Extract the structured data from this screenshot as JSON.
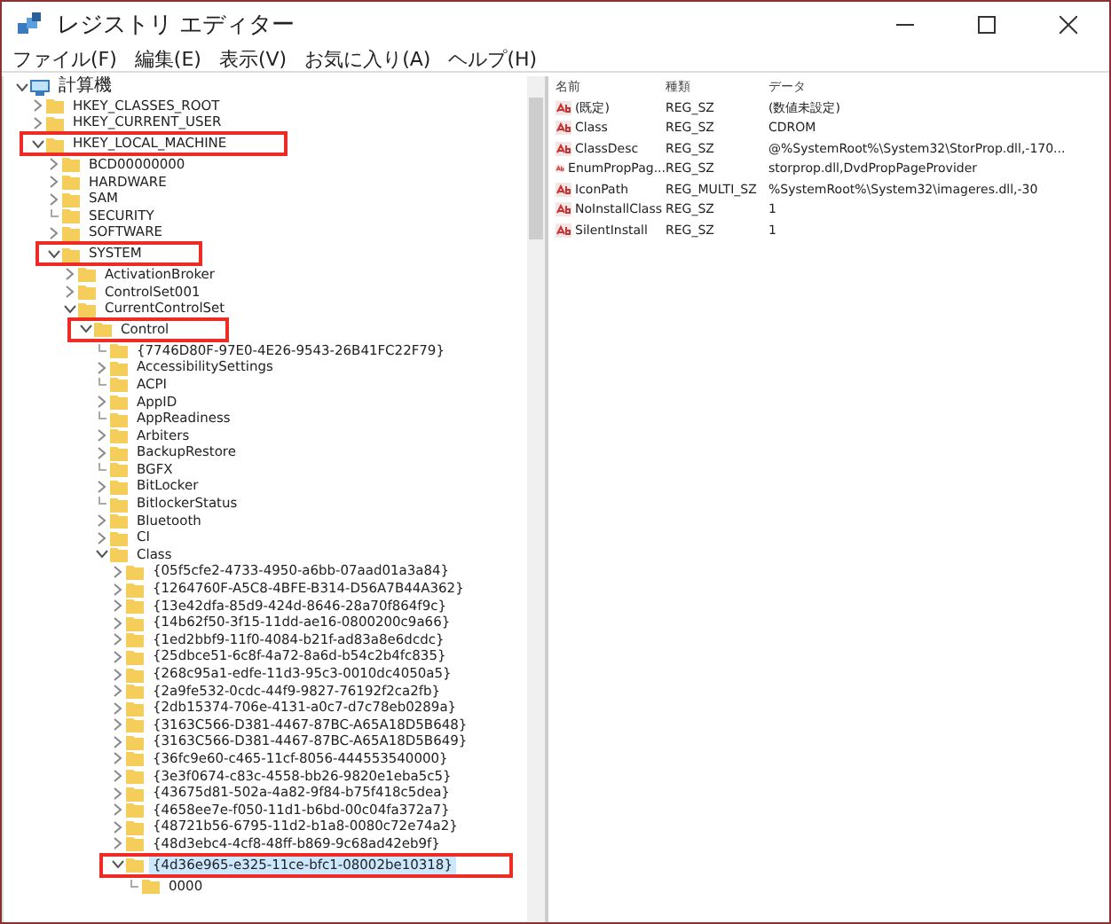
{
  "window": {
    "title": "レジストリ エディター"
  },
  "menu": [
    "ファイル(F)",
    "編集(E)",
    "表示(V)",
    "お気に入り(A)",
    "ヘルプ(H)"
  ],
  "tree": [
    {
      "label": "計算機",
      "kind": "expanded",
      "selected": false,
      "highlighted": false,
      "children": [
        {
          "label": "HKEY_CLASSES_ROOT",
          "kind": "collapsed",
          "selected": false,
          "highlighted": false
        },
        {
          "label": "HKEY_CURRENT_USER",
          "kind": "collapsed",
          "selected": false,
          "highlighted": false
        },
        {
          "label": "HKEY_LOCAL_MACHINE",
          "kind": "expanded",
          "selected": false,
          "highlighted": true,
          "children": [
            {
              "label": "BCD00000000",
              "kind": "collapsed",
              "selected": false,
              "highlighted": false
            },
            {
              "label": "HARDWARE",
              "kind": "collapsed",
              "selected": false,
              "highlighted": false
            },
            {
              "label": "SAM",
              "kind": "collapsed",
              "selected": false,
              "highlighted": false
            },
            {
              "label": "SECURITY",
              "kind": "leaf",
              "selected": false,
              "highlighted": false
            },
            {
              "label": "SOFTWARE",
              "kind": "collapsed",
              "selected": false,
              "highlighted": false
            },
            {
              "label": "SYSTEM",
              "kind": "expanded",
              "selected": false,
              "highlighted": true,
              "children": [
                {
                  "label": "ActivationBroker",
                  "kind": "collapsed",
                  "selected": false,
                  "highlighted": false
                },
                {
                  "label": "ControlSet001",
                  "kind": "collapsed",
                  "selected": false,
                  "highlighted": false
                },
                {
                  "label": "CurrentControlSet",
                  "kind": "expanded",
                  "selected": false,
                  "highlighted": false,
                  "children": [
                    {
                      "label": "Control",
                      "kind": "expanded",
                      "selected": false,
                      "highlighted": true,
                      "children": [
                        {
                          "label": "{7746D80F-97E0-4E26-9543-26B41FC22F79}",
                          "kind": "leaf",
                          "selected": false,
                          "highlighted": false
                        },
                        {
                          "label": "AccessibilitySettings",
                          "kind": "collapsed",
                          "selected": false,
                          "highlighted": false
                        },
                        {
                          "label": "ACPI",
                          "kind": "leaf",
                          "selected": false,
                          "highlighted": false
                        },
                        {
                          "label": "AppID",
                          "kind": "collapsed",
                          "selected": false,
                          "highlighted": false
                        },
                        {
                          "label": "AppReadiness",
                          "kind": "leaf",
                          "selected": false,
                          "highlighted": false
                        },
                        {
                          "label": "Arbiters",
                          "kind": "collapsed",
                          "selected": false,
                          "highlighted": false
                        },
                        {
                          "label": "BackupRestore",
                          "kind": "collapsed",
                          "selected": false,
                          "highlighted": false
                        },
                        {
                          "label": "BGFX",
                          "kind": "leaf",
                          "selected": false,
                          "highlighted": false
                        },
                        {
                          "label": "BitLocker",
                          "kind": "collapsed",
                          "selected": false,
                          "highlighted": false
                        },
                        {
                          "label": "BitlockerStatus",
                          "kind": "leaf",
                          "selected": false,
                          "highlighted": false
                        },
                        {
                          "label": "Bluetooth",
                          "kind": "collapsed",
                          "selected": false,
                          "highlighted": false
                        },
                        {
                          "label": "CI",
                          "kind": "collapsed",
                          "selected": false,
                          "highlighted": false
                        },
                        {
                          "label": "Class",
                          "kind": "expanded",
                          "selected": false,
                          "highlighted": false,
                          "children": [
                            {
                              "label": "{05f5cfe2-4733-4950-a6bb-07aad01a3a84}",
                              "kind": "collapsed",
                              "selected": false,
                              "highlighted": false
                            },
                            {
                              "label": "{1264760F-A5C8-4BFE-B314-D56A7B44A362}",
                              "kind": "collapsed",
                              "selected": false,
                              "highlighted": false
                            },
                            {
                              "label": "{13e42dfa-85d9-424d-8646-28a70f864f9c}",
                              "kind": "collapsed",
                              "selected": false,
                              "highlighted": false
                            },
                            {
                              "label": "{14b62f50-3f15-11dd-ae16-0800200c9a66}",
                              "kind": "collapsed",
                              "selected": false,
                              "highlighted": false
                            },
                            {
                              "label": "{1ed2bbf9-11f0-4084-b21f-ad83a8e6dcdc}",
                              "kind": "collapsed",
                              "selected": false,
                              "highlighted": false
                            },
                            {
                              "label": "{25dbce51-6c8f-4a72-8a6d-b54c2b4fc835}",
                              "kind": "collapsed",
                              "selected": false,
                              "highlighted": false
                            },
                            {
                              "label": "{268c95a1-edfe-11d3-95c3-0010dc4050a5}",
                              "kind": "collapsed",
                              "selected": false,
                              "highlighted": false
                            },
                            {
                              "label": "{2a9fe532-0cdc-44f9-9827-76192f2ca2fb}",
                              "kind": "collapsed",
                              "selected": false,
                              "highlighted": false
                            },
                            {
                              "label": "{2db15374-706e-4131-a0c7-d7c78eb0289a}",
                              "kind": "collapsed",
                              "selected": false,
                              "highlighted": false
                            },
                            {
                              "label": "{3163C566-D381-4467-87BC-A65A18D5B648}",
                              "kind": "collapsed",
                              "selected": false,
                              "highlighted": false
                            },
                            {
                              "label": "{3163C566-D381-4467-87BC-A65A18D5B649}",
                              "kind": "collapsed",
                              "selected": false,
                              "highlighted": false
                            },
                            {
                              "label": "{36fc9e60-c465-11cf-8056-444553540000}",
                              "kind": "collapsed",
                              "selected": false,
                              "highlighted": false
                            },
                            {
                              "label": "{3e3f0674-c83c-4558-bb26-9820e1eba5c5}",
                              "kind": "collapsed",
                              "selected": false,
                              "highlighted": false
                            },
                            {
                              "label": "{43675d81-502a-4a82-9f84-b75f418c5dea}",
                              "kind": "collapsed",
                              "selected": false,
                              "highlighted": false
                            },
                            {
                              "label": "{4658ee7e-f050-11d1-b6bd-00c04fa372a7}",
                              "kind": "collapsed",
                              "selected": false,
                              "highlighted": false
                            },
                            {
                              "label": "{48721b56-6795-11d2-b1a8-0080c72e74a2}",
                              "kind": "collapsed",
                              "selected": false,
                              "highlighted": false
                            },
                            {
                              "label": "{48d3ebc4-4cf8-48ff-b869-9c68ad42eb9f}",
                              "kind": "collapsed",
                              "selected": false,
                              "highlighted": false
                            },
                            {
                              "label": "{4d36e965-e325-11ce-bfc1-08002be10318}",
                              "kind": "expanded",
                              "selected": true,
                              "highlighted": true,
                              "children": [
                                {
                                  "label": "0000",
                                  "kind": "leaf",
                                  "selected": false,
                                  "highlighted": false
                                }
                              ]
                            }
                          ]
                        }
                      ]
                    }
                  ]
                }
              ]
            }
          ]
        }
      ]
    }
  ],
  "values": {
    "columns": [
      "名前",
      "種類",
      "データ"
    ],
    "rows": [
      {
        "name": "(既定)",
        "type": "REG_SZ",
        "data": "(数値未設定)"
      },
      {
        "name": "Class",
        "type": "REG_SZ",
        "data": "CDROM"
      },
      {
        "name": "ClassDesc",
        "type": "REG_SZ",
        "data": "@%SystemRoot%\\System32\\StorProp.dll,-170..."
      },
      {
        "name": "EnumPropPag...",
        "type": "REG_SZ",
        "data": "storprop.dll,DvdPropPageProvider"
      },
      {
        "name": "IconPath",
        "type": "REG_MULTI_SZ",
        "data": "%SystemRoot%\\System32\\imageres.dll,-30"
      },
      {
        "name": "NoInstallClass",
        "type": "REG_SZ",
        "data": "1"
      },
      {
        "name": "SilentInstall",
        "type": "REG_SZ",
        "data": "1"
      }
    ]
  }
}
